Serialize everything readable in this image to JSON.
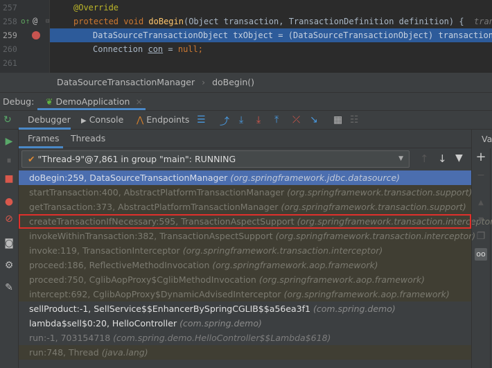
{
  "editor": {
    "lines": [
      {
        "num": "257"
      },
      {
        "num": "258"
      },
      {
        "num": "259"
      },
      {
        "num": "260"
      },
      {
        "num": "261"
      }
    ],
    "code": {
      "l257": "@Override",
      "l258_kw1": "protected",
      "l258_kw2": "void",
      "l258_fn": "doBegin",
      "l258_rest": "(Object transaction, TransactionDefinition definition) {",
      "l258_hint": "transac",
      "l259": "DataSourceTransactionObject txObject = (DataSourceTransactionObject) transaction;",
      "l260_a": "Connection ",
      "l260_b": "con",
      "l260_c": " = ",
      "l260_null": "null",
      ";": ";"
    }
  },
  "breadcrumb": {
    "class": "DataSourceTransactionManager",
    "method": "doBegin()"
  },
  "debug": {
    "label": "Debug:",
    "tab": "DemoApplication"
  },
  "toolbar": {
    "debugger": "Debugger",
    "console": "Console",
    "endpoints": "Endpoints"
  },
  "frames_tabs": {
    "frames": "Frames",
    "threads": "Threads"
  },
  "thread_select": "\"Thread-9\"@7,861 in group \"main\": RUNNING",
  "variables_label": "Var",
  "frames": [
    {
      "m": "doBegin:259, DataSourceTransactionManager",
      "p": "(org.springframework.jdbc.datasource)"
    },
    {
      "m": "startTransaction:400, AbstractPlatformTransactionManager",
      "p": "(org.springframework.transaction.support)"
    },
    {
      "m": "getTransaction:373, AbstractPlatformTransactionManager",
      "p": "(org.springframework.transaction.support)"
    },
    {
      "m": "createTransactionIfNecessary:595, TransactionAspectSupport",
      "p": "(org.springframework.transaction.interceptor)"
    },
    {
      "m": "invokeWithinTransaction:382, TransactionAspectSupport",
      "p": "(org.springframework.transaction.interceptor)"
    },
    {
      "m": "invoke:119, TransactionInterceptor",
      "p": "(org.springframework.transaction.interceptor)"
    },
    {
      "m": "proceed:186, ReflectiveMethodInvocation",
      "p": "(org.springframework.aop.framework)"
    },
    {
      "m": "proceed:750, CglibAopProxy$CglibMethodInvocation",
      "p": "(org.springframework.aop.framework)"
    },
    {
      "m": "intercept:692, CglibAopProxy$DynamicAdvisedInterceptor",
      "p": "(org.springframework.aop.framework)"
    },
    {
      "m": "sellProduct:-1, SellService$$EnhancerBySpringCGLIB$$a56ea3f1",
      "p": "(com.spring.demo)"
    },
    {
      "m": "lambda$sell$0:20, HelloController",
      "p": "(com.spring.demo)"
    },
    {
      "m": "run:-1, 703154718",
      "p": "(com.spring.demo.HelloController$$Lambda$618)"
    },
    {
      "m": "run:748, Thread",
      "p": "(java.lang)"
    }
  ]
}
